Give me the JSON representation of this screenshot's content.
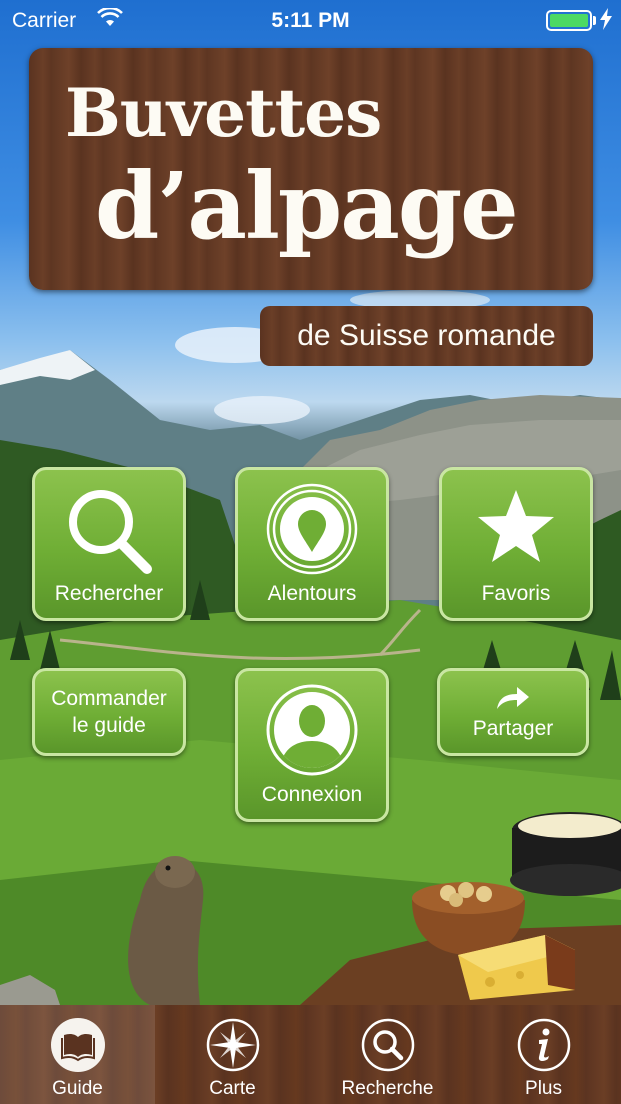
{
  "status_bar": {
    "carrier": "Carrier",
    "time": "5:11 PM",
    "wifi_icon": "wifi-icon",
    "battery_icon": "battery-icon",
    "charging_icon": "bolt-icon"
  },
  "header": {
    "title_line1": "Buvettes",
    "title_line2": "d’alpage",
    "subtitle": "de Suisse romande"
  },
  "menu": {
    "search": "Rechercher",
    "nearby": "Alentours",
    "favorites": "Favoris",
    "order_line1": "Commander",
    "order_line2": "le guide",
    "login": "Connexion",
    "share": "Partager"
  },
  "tabbar": {
    "items": [
      {
        "label": "Guide",
        "icon": "book-icon",
        "active": true
      },
      {
        "label": "Carte",
        "icon": "compass-icon",
        "active": false
      },
      {
        "label": "Recherche",
        "icon": "search-icon",
        "active": false
      },
      {
        "label": "Plus",
        "icon": "info-icon",
        "active": false
      }
    ]
  },
  "colors": {
    "button_green": "#6fae35",
    "button_border": "#c9e6a2",
    "wood": "#5e3622",
    "battery": "#4cd964"
  }
}
